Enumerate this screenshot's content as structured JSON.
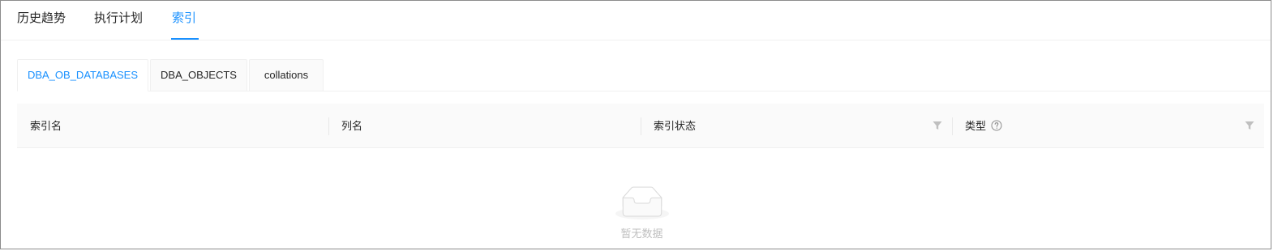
{
  "top_tabs": [
    {
      "label": "历史趋势",
      "active": false
    },
    {
      "label": "执行计划",
      "active": false
    },
    {
      "label": "索引",
      "active": true
    }
  ],
  "card_tabs": [
    {
      "label": "DBA_OB_DATABASES",
      "active": true
    },
    {
      "label": "DBA_OBJECTS",
      "active": false
    },
    {
      "label": "collations",
      "active": false
    }
  ],
  "table": {
    "columns": [
      {
        "label": "索引名",
        "filter": false,
        "help": false
      },
      {
        "label": "列名",
        "filter": false,
        "help": false
      },
      {
        "label": "索引状态",
        "filter": true,
        "help": false
      },
      {
        "label": "类型",
        "filter": true,
        "help": true
      }
    ],
    "empty_text": "暂无数据"
  },
  "colors": {
    "accent": "#1890ff",
    "text": "#262626",
    "muted": "#bfbfbf",
    "header_bg": "#fafafa",
    "border": "#f0f0f0"
  },
  "icons": {
    "filter": "filter-icon",
    "help": "question-circle-icon",
    "empty": "empty-inbox-icon"
  }
}
